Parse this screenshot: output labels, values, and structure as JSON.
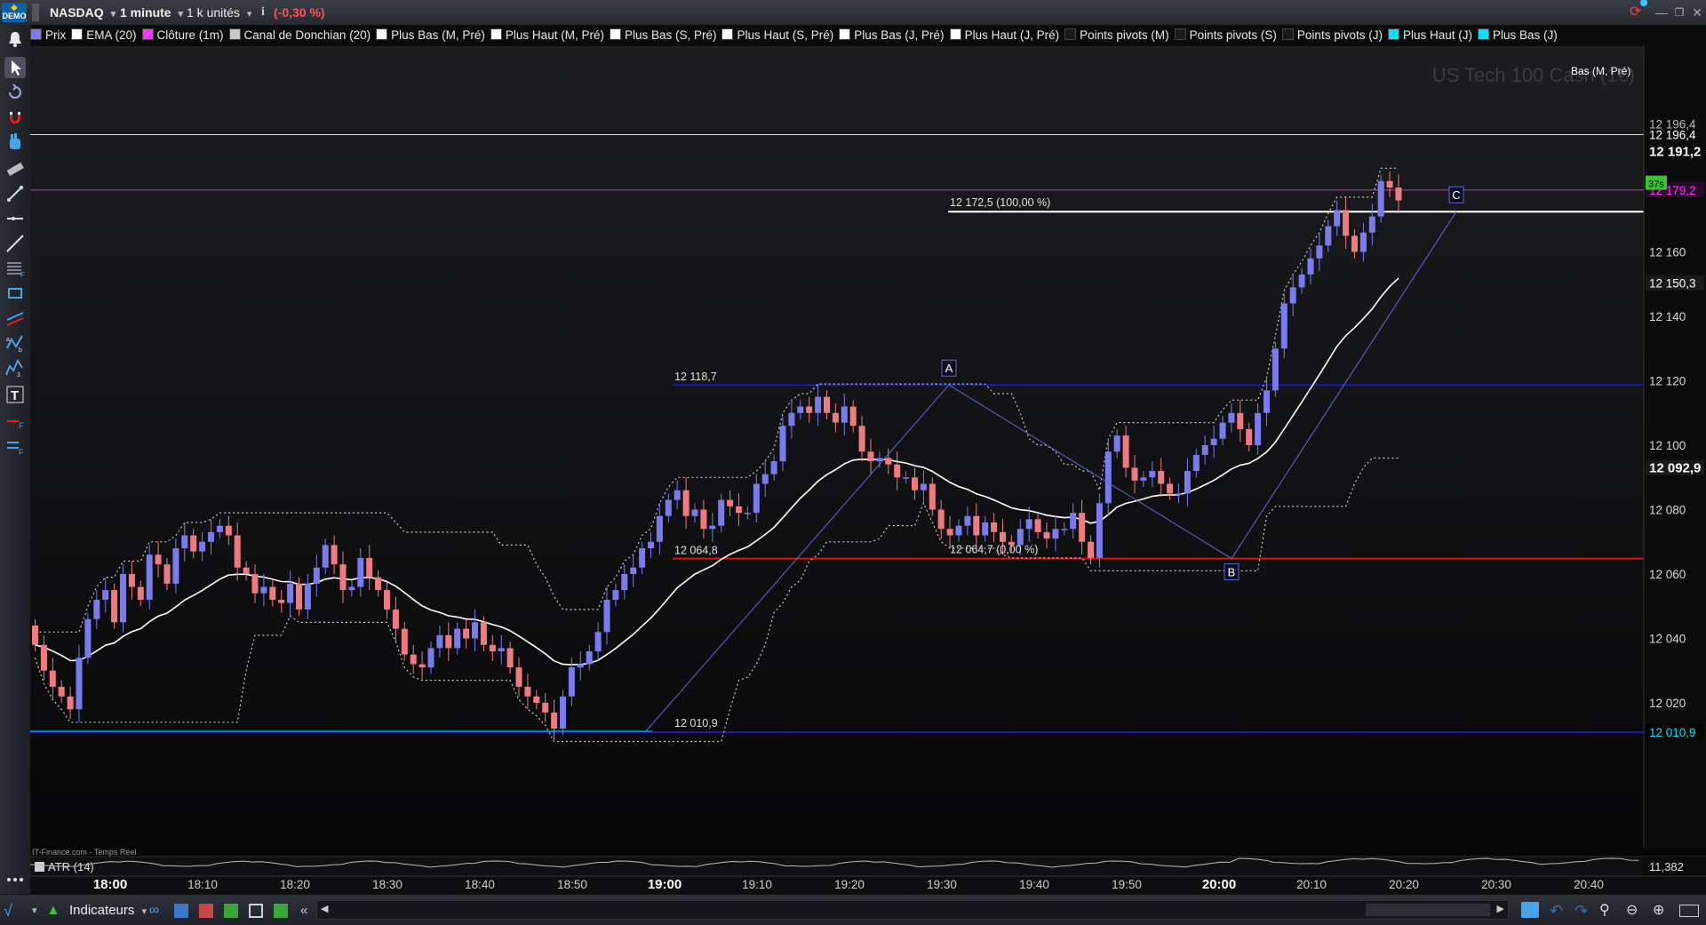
{
  "topbar": {
    "demo_badge": "DEMO",
    "instrument": "NASDAQ",
    "timeframe": "1 minute",
    "units": "1 k unités",
    "info_button": "i",
    "change": "(-0,30 %)",
    "change_color": "#ff5050"
  },
  "legend": [
    {
      "label": "Prix",
      "color": "#7b7bf0"
    },
    {
      "label": "EMA (20)",
      "color": "#ffffff"
    },
    {
      "label": "Clôture (1m)",
      "color": "#ff33ff"
    },
    {
      "label": "Canal de Donchian (20)",
      "color": "#c8c8c8"
    },
    {
      "label": "Plus Bas (M, Pré)",
      "color": "#ffffff"
    },
    {
      "label": "Plus Haut (M, Pré)",
      "color": "#ffffff"
    },
    {
      "label": "Plus Bas (S, Pré)",
      "color": "#ffffff"
    },
    {
      "label": "Plus Haut (S, Pré)",
      "color": "#ffffff"
    },
    {
      "label": "Plus Bas (J, Pré)",
      "color": "#ffffff"
    },
    {
      "label": "Plus Haut (J, Pré)",
      "color": "#ffffff"
    },
    {
      "label": "Points pivots (M)",
      "color": "#1a1a1a"
    },
    {
      "label": "Points pivots (S)",
      "color": "#1a1a1a"
    },
    {
      "label": "Points pivots (J)",
      "color": "#1a1a1a"
    },
    {
      "label": "Plus Haut (J)",
      "color": "#00e5ff"
    },
    {
      "label": "Plus Bas (J)",
      "color": "#00e5ff"
    }
  ],
  "watermark": "US Tech 100 Cash (1€)",
  "source_label": "IT-Finance.com - Temps Réel",
  "atr_label": "ATR (14)",
  "countdown_badge": "37s",
  "ref_label": "Bas (M, Pré)",
  "price_axis": {
    "ticks": [
      "12 160",
      "12 140",
      "12 120",
      "12 100",
      "12 080",
      "12 060",
      "12 040",
      "12 020"
    ],
    "tags": {
      "top1": "12 196,4",
      "top2": "12 196,4",
      "last": "12 191,2",
      "close": "12 179,2",
      "partial": "80",
      "level1": "12 150,3",
      "level2": "12 092,9",
      "low": "12 010,9",
      "atr": "11,382"
    },
    "close_color": "#ff33ff"
  },
  "time_axis": [
    "18:00",
    "18:10",
    "18:20",
    "18:30",
    "18:40",
    "18:50",
    "19:00",
    "19:10",
    "19:20",
    "19:30",
    "19:40",
    "19:50",
    "20:00",
    "20:10",
    "20:20",
    "20:30",
    "20:40"
  ],
  "annotations": {
    "h_high": "12 118,7",
    "h_mid": "12 064,8",
    "low": "12 010,9",
    "retrace_top": "12 172,5 (100,00 %)",
    "retrace_bottom": "12 064,7 (0,00 %)",
    "point_a": "A",
    "point_b": "B",
    "point_c": "C"
  },
  "bottombar": {
    "indicators_label": "Indicateurs"
  },
  "colors": {
    "bull": "#7b7bf0",
    "bear": "#ef7b80",
    "ema": "#ffffff",
    "support": "#e01010",
    "resistance": "#1a1ab0",
    "cyan": "#00e5ff"
  }
}
